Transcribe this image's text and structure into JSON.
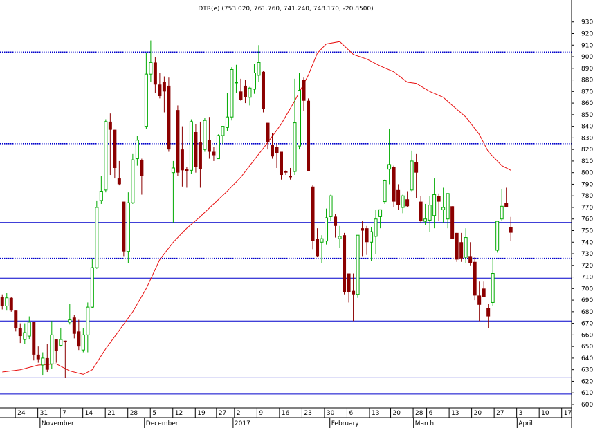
{
  "chart_data": {
    "type": "candlestick",
    "title": "DTR(e) (753.020, 761.760, 741.240, 748.170, -20.8500)",
    "ylim": [
      597,
      937
    ],
    "y_ticks": [
      600,
      610,
      620,
      630,
      640,
      650,
      660,
      670,
      680,
      690,
      700,
      710,
      720,
      730,
      740,
      750,
      760,
      770,
      780,
      790,
      800,
      810,
      820,
      830,
      840,
      850,
      860,
      870,
      880,
      890,
      900,
      910,
      920,
      930
    ],
    "x_day_ticks": [
      {
        "label": "24",
        "bar": 2.9
      },
      {
        "label": "31",
        "bar": 7.9
      },
      {
        "label": "7",
        "bar": 12.9
      },
      {
        "label": "14",
        "bar": 17.9
      },
      {
        "label": "21",
        "bar": 22.9
      },
      {
        "label": "28",
        "bar": 27.9
      },
      {
        "label": "5",
        "bar": 32.9
      },
      {
        "label": "12",
        "bar": 37.9
      },
      {
        "label": "19",
        "bar": 42.9
      },
      {
        "label": "27",
        "bar": 47.6
      },
      {
        "label": "2",
        "bar": 51.6
      },
      {
        "label": "9",
        "bar": 56.6
      },
      {
        "label": "16",
        "bar": 61.6
      },
      {
        "label": "23",
        "bar": 66.6
      },
      {
        "label": "30",
        "bar": 71.6
      },
      {
        "label": "6",
        "bar": 76.6
      },
      {
        "label": "13",
        "bar": 81.6
      },
      {
        "label": "20",
        "bar": 86.3
      },
      {
        "label": "28",
        "bar": 91.3
      },
      {
        "label": "6",
        "bar": 94.3
      },
      {
        "label": "13",
        "bar": 99.3
      },
      {
        "label": "20",
        "bar": 104.3
      },
      {
        "label": "27",
        "bar": 109.3
      },
      {
        "label": "3",
        "bar": 114.3
      },
      {
        "label": "10",
        "bar": 119.3
      },
      {
        "label": "17",
        "bar": 124.3
      }
    ],
    "x_month_labels": [
      {
        "label": "November",
        "bar": 8.4
      },
      {
        "label": "December",
        "bar": 31.6
      },
      {
        "label": "2017",
        "bar": 51.3
      },
      {
        "label": "February",
        "bar": 72.8
      },
      {
        "label": "March",
        "bar": 91.4
      },
      {
        "label": "April",
        "bar": 114.4
      }
    ],
    "bar_range": [
      -0.5,
      126.5
    ],
    "horizontal_lines": [
      {
        "value": 904,
        "style": "dotted",
        "color": "#0000cc"
      },
      {
        "value": 825,
        "style": "dotted",
        "color": "#0000cc"
      },
      {
        "value": 757,
        "style": "solid",
        "color": "#0000cc"
      },
      {
        "value": 726,
        "style": "dotted",
        "color": "#0000cc"
      },
      {
        "value": 709,
        "style": "solid",
        "color": "#0000cc"
      },
      {
        "value": 672,
        "style": "solid",
        "color": "#0000cc"
      },
      {
        "value": 623,
        "style": "solid",
        "color": "#0000cc"
      },
      {
        "value": 609,
        "style": "solid",
        "color": "#0000cc"
      }
    ],
    "moving_average": {
      "color": "#e81010",
      "points": [
        [
          0,
          628
        ],
        [
          4,
          630
        ],
        [
          8,
          634
        ],
        [
          12,
          635
        ],
        [
          15,
          629
        ],
        [
          18,
          626
        ],
        [
          20,
          630
        ],
        [
          23,
          648
        ],
        [
          26,
          664
        ],
        [
          29,
          680
        ],
        [
          32,
          700
        ],
        [
          35,
          725
        ],
        [
          38,
          740
        ],
        [
          41,
          752
        ],
        [
          44,
          762
        ],
        [
          47,
          773
        ],
        [
          50,
          784
        ],
        [
          53,
          796
        ],
        [
          56,
          811
        ],
        [
          59,
          826
        ],
        [
          62,
          842
        ],
        [
          65,
          862
        ],
        [
          68,
          884
        ],
        [
          70,
          903
        ],
        [
          72,
          911
        ],
        [
          75,
          913
        ],
        [
          78,
          902
        ],
        [
          81,
          898
        ],
        [
          84,
          892
        ],
        [
          87,
          887
        ],
        [
          90,
          878
        ],
        [
          92,
          877
        ],
        [
          95,
          870
        ],
        [
          98,
          865
        ],
        [
          100,
          858
        ],
        [
          103,
          848
        ],
        [
          106,
          833
        ],
        [
          108,
          818
        ],
        [
          111,
          806
        ],
        [
          113,
          802
        ]
      ]
    },
    "colors": {
      "up": "#00aa00",
      "down": "#8b0000",
      "background": "#ffffff",
      "axis": "#000000"
    },
    "candles": [
      {
        "o": 693,
        "h": 695,
        "l": 682,
        "c": 685
      },
      {
        "o": 685,
        "h": 696,
        "l": 681,
        "c": 692
      },
      {
        "o": 692,
        "h": 693,
        "l": 680,
        "c": 681
      },
      {
        "o": 681,
        "h": 681,
        "l": 663,
        "c": 666
      },
      {
        "o": 666,
        "h": 670,
        "l": 653,
        "c": 659
      },
      {
        "o": 656,
        "h": 670,
        "l": 652,
        "c": 662
      },
      {
        "o": 659,
        "h": 676,
        "l": 656,
        "c": 671
      },
      {
        "o": 671,
        "h": 671,
        "l": 638,
        "c": 643
      },
      {
        "o": 643,
        "h": 650,
        "l": 636,
        "c": 639
      },
      {
        "o": 634,
        "h": 645,
        "l": 625,
        "c": 640
      },
      {
        "o": 640,
        "h": 652,
        "l": 628,
        "c": 630
      },
      {
        "o": 635,
        "h": 672,
        "l": 631,
        "c": 660
      },
      {
        "o": 656,
        "h": 656,
        "l": 636,
        "c": 646
      },
      {
        "o": 651,
        "h": 666,
        "l": 650,
        "c": 656
      },
      {
        "o": 655,
        "h": 655,
        "l": 623,
        "c": 654
      },
      {
        "o": 671,
        "h": 687,
        "l": 669,
        "c": 673
      },
      {
        "o": 675,
        "h": 677,
        "l": 657,
        "c": 661
      },
      {
        "o": 663,
        "h": 673,
        "l": 647,
        "c": 650
      },
      {
        "o": 647,
        "h": 666,
        "l": 645,
        "c": 660
      },
      {
        "o": 660,
        "h": 688,
        "l": 645,
        "c": 684
      },
      {
        "o": 684,
        "h": 726,
        "l": 683,
        "c": 718
      },
      {
        "o": 718,
        "h": 776,
        "l": 717,
        "c": 770
      },
      {
        "o": 776,
        "h": 797,
        "l": 773,
        "c": 784
      },
      {
        "o": 785,
        "h": 846,
        "l": 783,
        "c": 844
      },
      {
        "o": 844,
        "h": 851,
        "l": 798,
        "c": 837
      },
      {
        "o": 837,
        "h": 837,
        "l": 795,
        "c": 804
      },
      {
        "o": 795,
        "h": 810,
        "l": 789,
        "c": 790
      },
      {
        "o": 775,
        "h": 775,
        "l": 728,
        "c": 732
      },
      {
        "o": 732,
        "h": 783,
        "l": 722,
        "c": 774
      },
      {
        "o": 774,
        "h": 816,
        "l": 773,
        "c": 811
      },
      {
        "o": 812,
        "h": 832,
        "l": 806,
        "c": 828
      },
      {
        "o": 811,
        "h": 812,
        "l": 781,
        "c": 797
      },
      {
        "o": 840,
        "h": 903,
        "l": 838,
        "c": 885
      },
      {
        "o": 885,
        "h": 914,
        "l": 878,
        "c": 895
      },
      {
        "o": 895,
        "h": 900,
        "l": 869,
        "c": 876
      },
      {
        "o": 876,
        "h": 886,
        "l": 864,
        "c": 866
      },
      {
        "o": 878,
        "h": 883,
        "l": 852,
        "c": 870
      },
      {
        "o": 875,
        "h": 882,
        "l": 818,
        "c": 820
      },
      {
        "o": 800,
        "h": 810,
        "l": 757,
        "c": 804
      },
      {
        "o": 854,
        "h": 858,
        "l": 797,
        "c": 800
      },
      {
        "o": 820,
        "h": 840,
        "l": 788,
        "c": 802
      },
      {
        "o": 803,
        "h": 805,
        "l": 787,
        "c": 801
      },
      {
        "o": 802,
        "h": 846,
        "l": 799,
        "c": 844
      },
      {
        "o": 835,
        "h": 842,
        "l": 800,
        "c": 805
      },
      {
        "o": 826,
        "h": 844,
        "l": 787,
        "c": 803
      },
      {
        "o": 820,
        "h": 847,
        "l": 818,
        "c": 845
      },
      {
        "o": 828,
        "h": 848,
        "l": 812,
        "c": 818
      },
      {
        "o": 818,
        "h": 822,
        "l": 810,
        "c": 815
      },
      {
        "o": 812,
        "h": 833,
        "l": 812,
        "c": 832
      },
      {
        "o": 832,
        "h": 840,
        "l": 825,
        "c": 840
      },
      {
        "o": 839,
        "h": 869,
        "l": 836,
        "c": 848
      },
      {
        "o": 848,
        "h": 891,
        "l": 845,
        "c": 889
      },
      {
        "o": 878,
        "h": 893,
        "l": 869,
        "c": 878
      },
      {
        "o": 870,
        "h": 881,
        "l": 862,
        "c": 863
      },
      {
        "o": 875,
        "h": 880,
        "l": 860,
        "c": 865
      },
      {
        "o": 865,
        "h": 874,
        "l": 858,
        "c": 873
      },
      {
        "o": 872,
        "h": 894,
        "l": 868,
        "c": 886
      },
      {
        "o": 884,
        "h": 910,
        "l": 878,
        "c": 895
      },
      {
        "o": 887,
        "h": 888,
        "l": 852,
        "c": 855
      },
      {
        "o": 843,
        "h": 843,
        "l": 820,
        "c": 826
      },
      {
        "o": 824,
        "h": 834,
        "l": 812,
        "c": 814
      },
      {
        "o": 822,
        "h": 825,
        "l": 804,
        "c": 817
      },
      {
        "o": 818,
        "h": 818,
        "l": 794,
        "c": 798
      },
      {
        "o": 801,
        "h": 802,
        "l": 798,
        "c": 800
      },
      {
        "o": 797,
        "h": 804,
        "l": 794,
        "c": 796
      },
      {
        "o": 801,
        "h": 881,
        "l": 798,
        "c": 843
      },
      {
        "o": 823,
        "h": 886,
        "l": 820,
        "c": 871
      },
      {
        "o": 880,
        "h": 882,
        "l": 853,
        "c": 862
      },
      {
        "o": 862,
        "h": 864,
        "l": 803,
        "c": 801
      },
      {
        "o": 788,
        "h": 789,
        "l": 734,
        "c": 741
      },
      {
        "o": 743,
        "h": 752,
        "l": 727,
        "c": 728
      },
      {
        "o": 740,
        "h": 746,
        "l": 722,
        "c": 743
      },
      {
        "o": 741,
        "h": 769,
        "l": 738,
        "c": 761
      },
      {
        "o": 762,
        "h": 781,
        "l": 758,
        "c": 780
      },
      {
        "o": 762,
        "h": 764,
        "l": 744,
        "c": 754
      },
      {
        "o": 743,
        "h": 754,
        "l": 735,
        "c": 745
      },
      {
        "o": 746,
        "h": 748,
        "l": 695,
        "c": 697
      },
      {
        "o": 713,
        "h": 713,
        "l": 688,
        "c": 697
      },
      {
        "o": 698,
        "h": 713,
        "l": 672,
        "c": 695
      },
      {
        "o": 695,
        "h": 745,
        "l": 692,
        "c": 746
      },
      {
        "o": 752,
        "h": 758,
        "l": 728,
        "c": 750
      },
      {
        "o": 752,
        "h": 754,
        "l": 729,
        "c": 740
      },
      {
        "o": 740,
        "h": 753,
        "l": 724,
        "c": 749
      },
      {
        "o": 745,
        "h": 768,
        "l": 730,
        "c": 760
      },
      {
        "o": 762,
        "h": 764,
        "l": 752,
        "c": 768
      },
      {
        "o": 775,
        "h": 794,
        "l": 773,
        "c": 793
      },
      {
        "o": 803,
        "h": 838,
        "l": 790,
        "c": 807
      },
      {
        "o": 805,
        "h": 806,
        "l": 770,
        "c": 775
      },
      {
        "o": 785,
        "h": 790,
        "l": 768,
        "c": 772
      },
      {
        "o": 770,
        "h": 781,
        "l": 765,
        "c": 780
      },
      {
        "o": 777,
        "h": 784,
        "l": 770,
        "c": 771
      },
      {
        "o": 785,
        "h": 819,
        "l": 784,
        "c": 810
      },
      {
        "o": 809,
        "h": 816,
        "l": 778,
        "c": 800
      },
      {
        "o": 775,
        "h": 780,
        "l": 757,
        "c": 758
      },
      {
        "o": 758,
        "h": 773,
        "l": 755,
        "c": 760
      },
      {
        "o": 759,
        "h": 780,
        "l": 749,
        "c": 772
      },
      {
        "o": 763,
        "h": 795,
        "l": 752,
        "c": 781
      },
      {
        "o": 780,
        "h": 782,
        "l": 758,
        "c": 775
      },
      {
        "o": 768,
        "h": 787,
        "l": 757,
        "c": 770
      },
      {
        "o": 760,
        "h": 780,
        "l": 752,
        "c": 782
      },
      {
        "o": 771,
        "h": 771,
        "l": 745,
        "c": 743
      },
      {
        "o": 748,
        "h": 748,
        "l": 723,
        "c": 725
      },
      {
        "o": 740,
        "h": 748,
        "l": 723,
        "c": 726
      },
      {
        "o": 727,
        "h": 752,
        "l": 722,
        "c": 744
      },
      {
        "o": 728,
        "h": 740,
        "l": 720,
        "c": 722
      },
      {
        "o": 723,
        "h": 727,
        "l": 690,
        "c": 694
      },
      {
        "o": 694,
        "h": 706,
        "l": 672,
        "c": 686
      },
      {
        "o": 700,
        "h": 706,
        "l": 697,
        "c": 693
      },
      {
        "o": 683,
        "h": 687,
        "l": 666,
        "c": 676
      },
      {
        "o": 688,
        "h": 726,
        "l": 685,
        "c": 713
      },
      {
        "o": 733,
        "h": 758,
        "l": 731,
        "c": 758
      },
      {
        "o": 760,
        "h": 786,
        "l": 758,
        "c": 771
      },
      {
        "o": 774,
        "h": 787,
        "l": 770,
        "c": 770
      },
      {
        "o": 753,
        "h": 761.76,
        "l": 741.24,
        "c": 748.17
      }
    ]
  }
}
